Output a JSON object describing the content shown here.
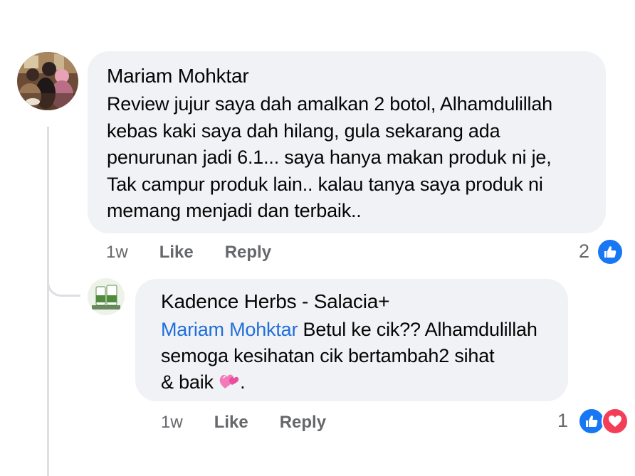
{
  "comments": [
    {
      "author": "Mariam Mohktar",
      "text": "Review jujur saya dah amalkan 2 botol, Alhamdulillah\nkebas kaki saya dah hilang, gula sekarang ada\npenurunan jadi 6.1... saya hanya makan produk ni je,\nTak campur produk lain.. kalau tanya saya produk ni\nmemang menjadi dan terbaik..",
      "time": "1w",
      "like_label": "Like",
      "reply_label": "Reply",
      "reaction_count": "2",
      "reactions": [
        "like-icon"
      ]
    }
  ],
  "reply": {
    "author": "Kadence Herbs - Salacia+",
    "mention": "Mariam Mohktar",
    "text": " Betul ke cik?? Alhamdulillah\nsemoga kesihatan cik bertambah2 sihat\n& baik ",
    "text_end": ".",
    "emoji": "heart-emoji",
    "time": "1w",
    "like_label": "Like",
    "reply_label": "Reply",
    "reaction_count": "1",
    "reactions": [
      "like-icon",
      "love-icon"
    ]
  },
  "colors": {
    "bubble": "#f0f2f5",
    "mention": "#216fdb",
    "like": "#1877f2",
    "love": "#f33e58",
    "meta": "#65676b"
  }
}
